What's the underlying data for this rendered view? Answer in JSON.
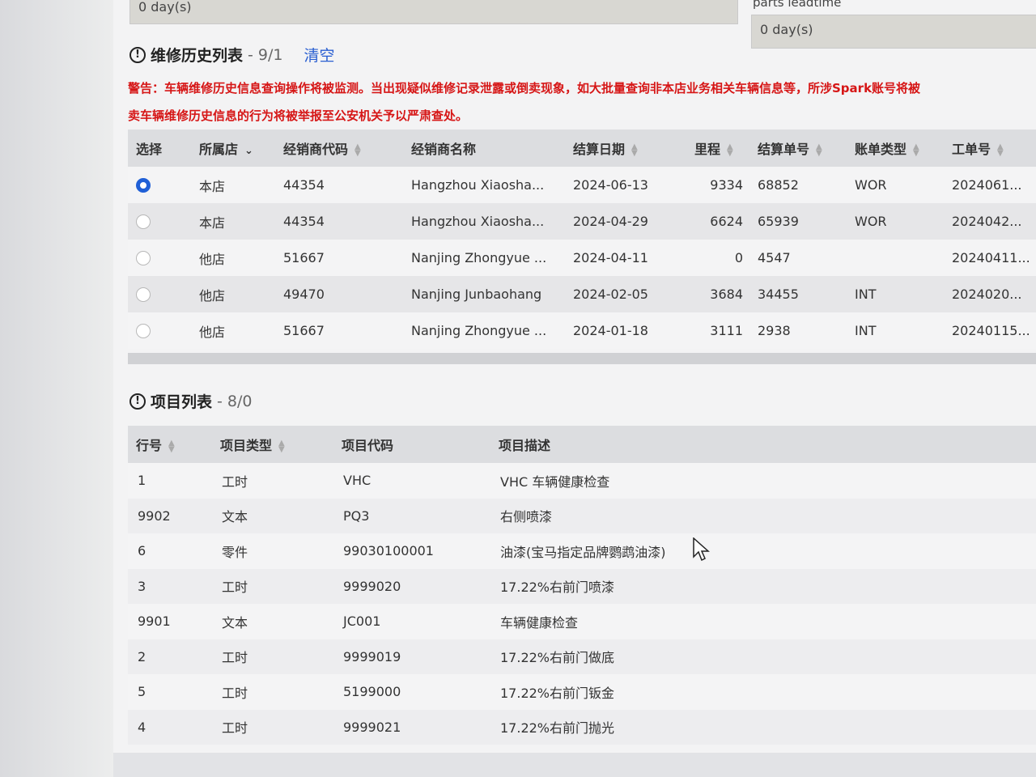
{
  "top": {
    "field1_value": "0 day(s)",
    "label2": "parts leadtime",
    "field2_value": "0 day(s)"
  },
  "history": {
    "title": "维修历史列表",
    "count": "- 9/1",
    "clear": "清空",
    "warning_line1": "警告：车辆维修历史信息查询操作将被监测。当出现疑似维修记录泄露或倒卖现象，如大批量查询非本店业务相关车辆信息等，所涉Spark账号将被",
    "warning_line2": "卖车辆维修历史信息的行为将被举报至公安机关予以严肃查处。",
    "columns": [
      "选择",
      "所属店",
      "经销商代码",
      "经销商名称",
      "结算日期",
      "里程",
      "结算单号",
      "账单类型",
      "工单号"
    ],
    "rows": [
      {
        "store": "本店",
        "code": "44354",
        "name": "Hangzhou Xiaosha...",
        "date": "2024-06-13",
        "mileage": "9334",
        "settle": "68852",
        "type": "WOR",
        "order": "2024061..."
      },
      {
        "store": "本店",
        "code": "44354",
        "name": "Hangzhou Xiaosha...",
        "date": "2024-04-29",
        "mileage": "6624",
        "settle": "65939",
        "type": "WOR",
        "order": "2024042..."
      },
      {
        "store": "他店",
        "code": "51667",
        "name": "Nanjing Zhongyue ...",
        "date": "2024-04-11",
        "mileage": "0",
        "settle": "4547",
        "type": "",
        "order": "20240411..."
      },
      {
        "store": "他店",
        "code": "49470",
        "name": "Nanjing Junbaohang",
        "date": "2024-02-05",
        "mileage": "3684",
        "settle": "34455",
        "type": "INT",
        "order": "2024020..."
      },
      {
        "store": "他店",
        "code": "51667",
        "name": "Nanjing Zhongyue ...",
        "date": "2024-01-18",
        "mileage": "3111",
        "settle": "2938",
        "type": "INT",
        "order": "20240115..."
      }
    ]
  },
  "projects": {
    "title": "项目列表",
    "count": "- 8/0",
    "columns": [
      "行号",
      "项目类型",
      "项目代码",
      "项目描述"
    ],
    "rows": [
      {
        "line": "1",
        "type": "工时",
        "code": "VHC",
        "desc": "VHC 车辆健康检查"
      },
      {
        "line": "9902",
        "type": "文本",
        "code": "PQ3",
        "desc": "右侧喷漆"
      },
      {
        "line": "6",
        "type": "零件",
        "code": "99030100001",
        "desc": "油漆(宝马指定品牌鹦鹉油漆)"
      },
      {
        "line": "3",
        "type": "工时",
        "code": "9999020",
        "desc": "17.22%右前门喷漆"
      },
      {
        "line": "9901",
        "type": "文本",
        "code": "JC001",
        "desc": "车辆健康检查"
      },
      {
        "line": "2",
        "type": "工时",
        "code": "9999019",
        "desc": "17.22%右前门做底"
      },
      {
        "line": "5",
        "type": "工时",
        "code": "5199000",
        "desc": "17.22%右前门钣金"
      },
      {
        "line": "4",
        "type": "工时",
        "code": "9999021",
        "desc": "17.22%右前门抛光"
      }
    ]
  }
}
